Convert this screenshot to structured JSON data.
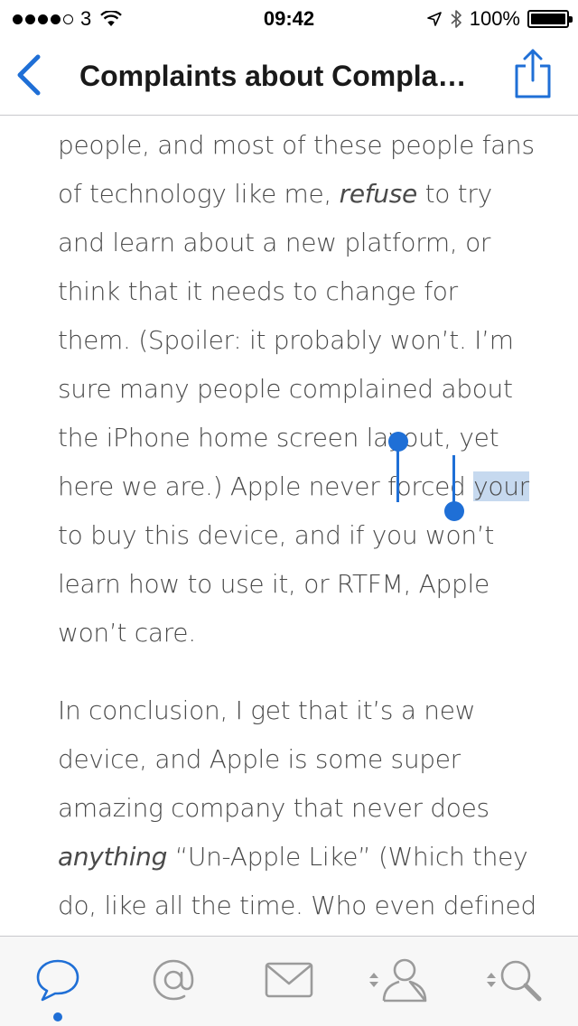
{
  "status_bar": {
    "carrier": "3",
    "time": "09:42",
    "battery_percent": "100%",
    "battery_level": 1.0
  },
  "nav": {
    "title": "Complaints about Compla…",
    "back_icon": "chevron-left-icon",
    "share_icon": "share-icon"
  },
  "article": {
    "p1": {
      "t1": "people, and most of these people fans of technology like me, ",
      "em1": "refuse",
      "t2": " to try and learn about a new platform, or think that it needs to change for them. (Spoiler: it probably won’t. I’m sure many people complained about the iPhone home screen layout, yet here we are.) Apple never forced ",
      "selected": "your",
      "t3": " to buy this device, and if you won’t learn how to use it, or RTFM, Apple won’t care."
    },
    "p2": {
      "t1": "In conclusion, I get that it’s a new device, and Apple is some super amazing company that never does ",
      "em1": "anything",
      "t2": " “Un-Apple Like” (Which they do, like all the time. Who even defined"
    }
  },
  "tab_bar": {
    "tabs": [
      {
        "icon": "speech-bubble-icon",
        "active": true
      },
      {
        "icon": "at-sign-icon",
        "active": false
      },
      {
        "icon": "envelope-icon",
        "active": false
      },
      {
        "icon": "profile-icon",
        "active": false
      },
      {
        "icon": "search-icon",
        "active": false
      }
    ],
    "accent_color": "#1f6fd6",
    "inactive_color": "#9b9b9b"
  }
}
